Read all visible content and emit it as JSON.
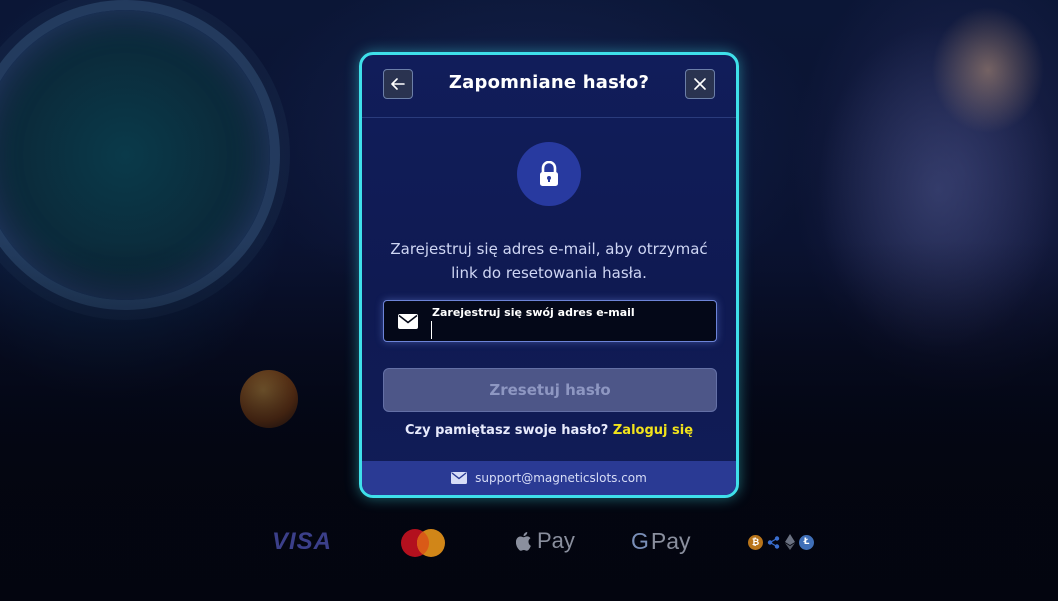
{
  "modal": {
    "title": "Zapomniane hasło?",
    "description": "Zarejestruj się adres e-mail, aby otrzymać link do resetowania hasła.",
    "email_label": "Zarejestruj się swój adres e-mail",
    "email_value": "",
    "reset_button": "Zresetuj hasło",
    "remember_text": "Czy pamiętasz swoje hasło?",
    "login_link": "Zaloguj się",
    "support_email": "support@magneticslots.com"
  },
  "payments": {
    "visa": "VISA",
    "apple_pay": "Pay",
    "google_pay": "Pay",
    "google_g": "G"
  },
  "colors": {
    "accent_border": "#3fe0ea",
    "modal_bg": "#111d5a",
    "link_yellow": "#f2e31b",
    "lock_circle": "#283aa0",
    "support_bar": "#2a3a94"
  },
  "icons": [
    "back-arrow-icon",
    "close-icon",
    "lock-icon",
    "mail-icon",
    "apple-icon",
    "bitcoin-icon",
    "ripple-icon",
    "ethereum-icon",
    "litecoin-icon"
  ]
}
